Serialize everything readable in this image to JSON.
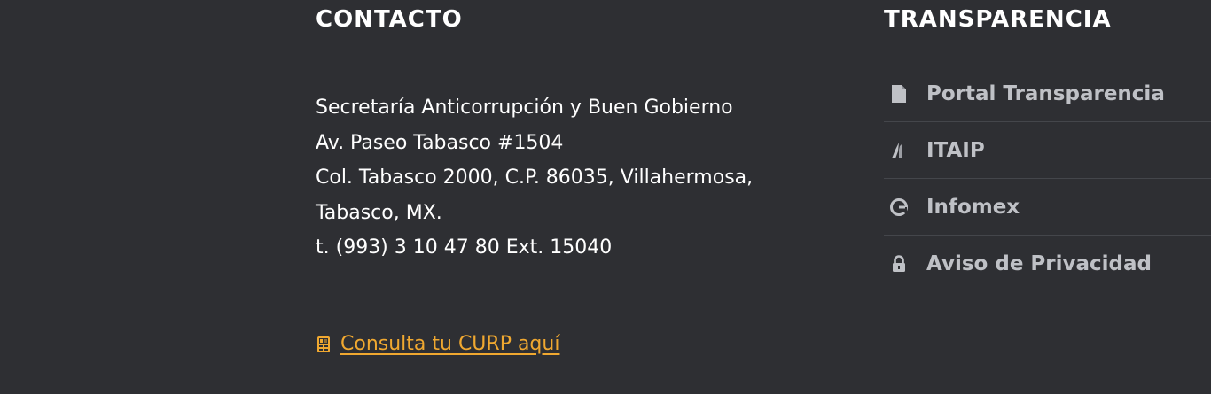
{
  "contact": {
    "heading": "CONTACTO",
    "address_lines": [
      "Secretaría Anticorrupción y Buen Gobierno",
      "Av. Paseo Tabasco #1504",
      "Col. Tabasco 2000, C.P. 86035, Villahermosa,",
      "Tabasco, MX.",
      "t. (993) 3 10 47 80 Ext. 15040"
    ],
    "curp_link": {
      "label": "Consulta tu CURP aquí",
      "icon": "id-card-icon"
    }
  },
  "transparency": {
    "heading": "TRANSPARENCIA",
    "items": [
      {
        "label": "Portal Transparencia",
        "icon": "document-icon"
      },
      {
        "label": "ITAIP",
        "icon": "itaip-logo-icon"
      },
      {
        "label": "Infomex",
        "icon": "infomex-logo-icon"
      },
      {
        "label": "Aviso de Privacidad",
        "icon": "lock-icon"
      }
    ]
  },
  "colors": {
    "background": "#2e2f33",
    "heading": "#ffffff",
    "body_text": "#ffffff",
    "link": "#f0a830",
    "list_text": "#bfc1c6",
    "divider": "#44464b"
  }
}
